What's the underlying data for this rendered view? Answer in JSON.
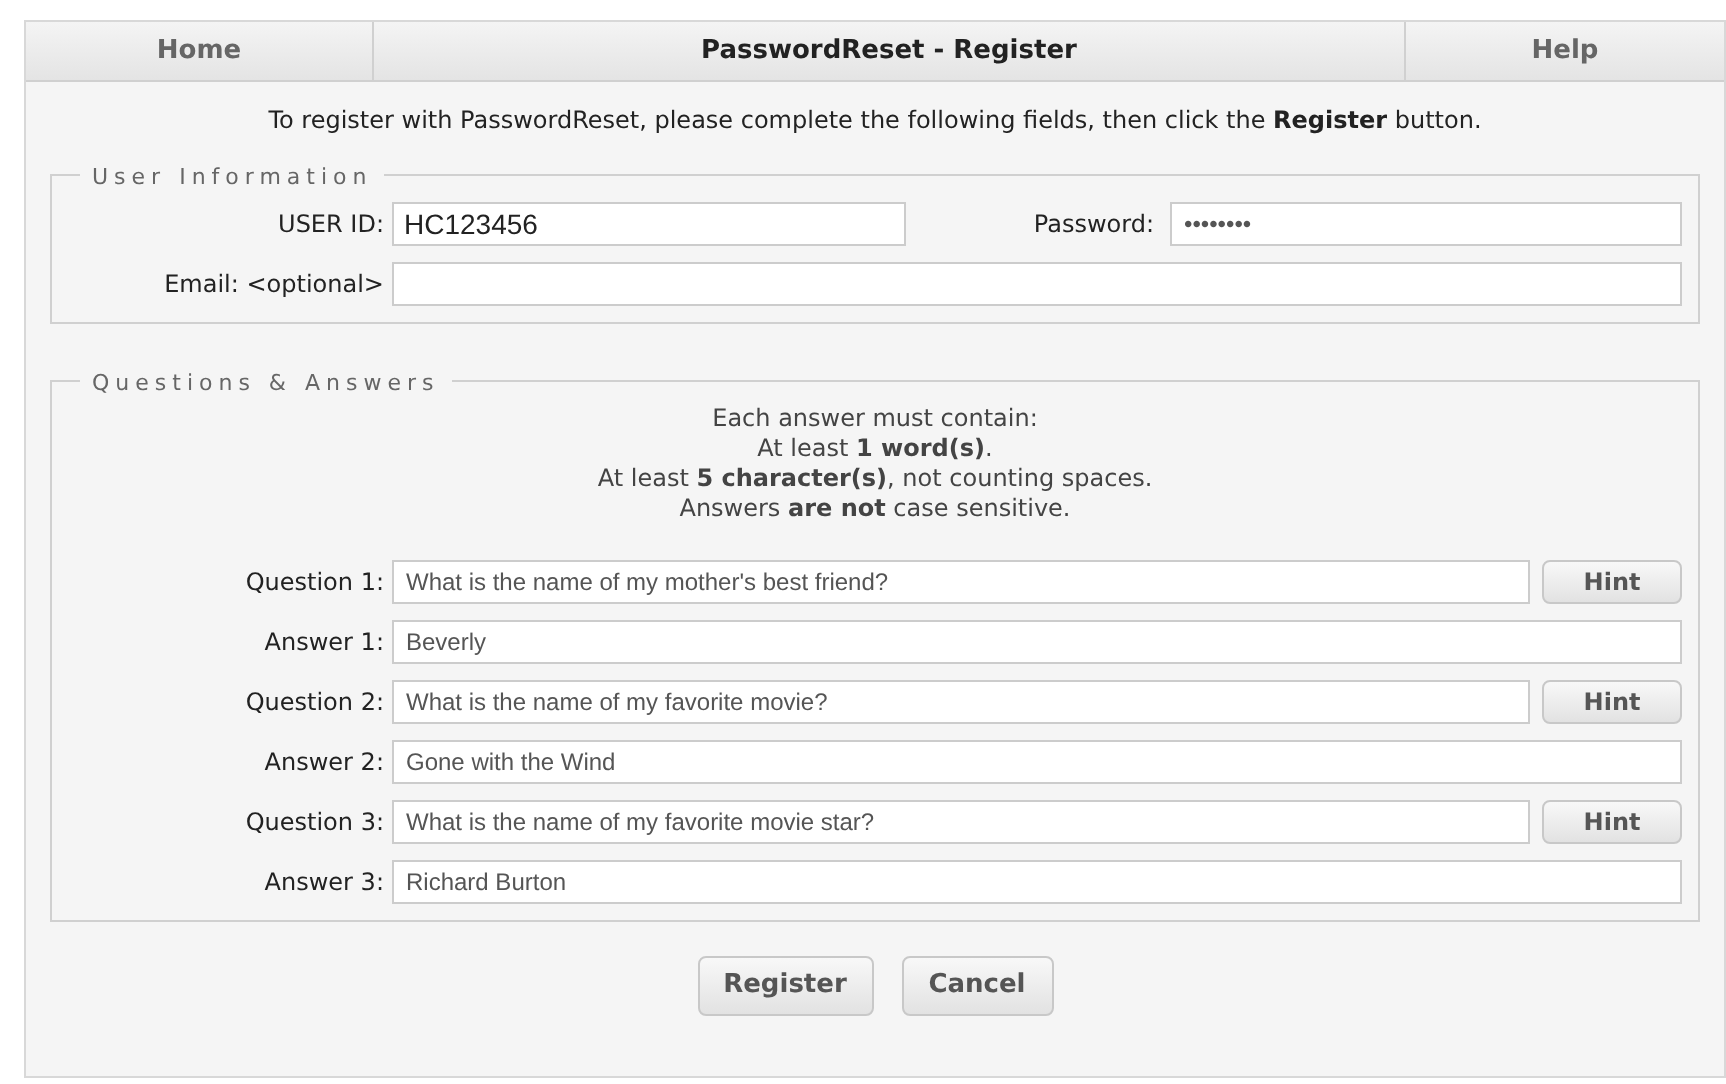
{
  "nav": [
    {
      "label": "Home",
      "kind": "link"
    },
    {
      "label": "PasswordReset - Register",
      "kind": "title"
    },
    {
      "label": "Help",
      "kind": "link"
    }
  ],
  "intro": "To register with PasswordReset, please complete the following fields, then click the **Register** button.",
  "user_information": {
    "legend": "User Information",
    "user_id": {
      "label": "USER ID:",
      "value": "HC123456"
    },
    "password": {
      "label": "Password:",
      "value": "••••••••"
    },
    "email": {
      "label": "Email: <optional>"
    }
  },
  "questions_answers": {
    "legend": "Questions & Answers",
    "rules": [
      "Each answer must contain:",
      "At least **1 word(s)**.",
      "At least **5 character(s)**, not counting spaces.",
      "Answers **are not** case sensitive."
    ],
    "rows": [
      {
        "kind": "question",
        "label": "Question 1:",
        "value": "What is the name of my mother's best friend?",
        "button": "Hint"
      },
      {
        "kind": "answer",
        "label": "Answer 1:",
        "value": "Beverly"
      },
      {
        "kind": "question",
        "label": "Question 2:",
        "value": "What is the name of my favorite movie?",
        "button": "Hint"
      },
      {
        "kind": "answer",
        "label": "Answer 2:",
        "value": "Gone with the Wind"
      },
      {
        "kind": "question",
        "label": "Question 3:",
        "value": "What is the name of my favorite movie star?",
        "button": "Hint"
      },
      {
        "kind": "answer",
        "label": "Answer 3:",
        "value": "Richard Burton"
      }
    ]
  },
  "buttons": [
    "Register",
    "Cancel"
  ]
}
